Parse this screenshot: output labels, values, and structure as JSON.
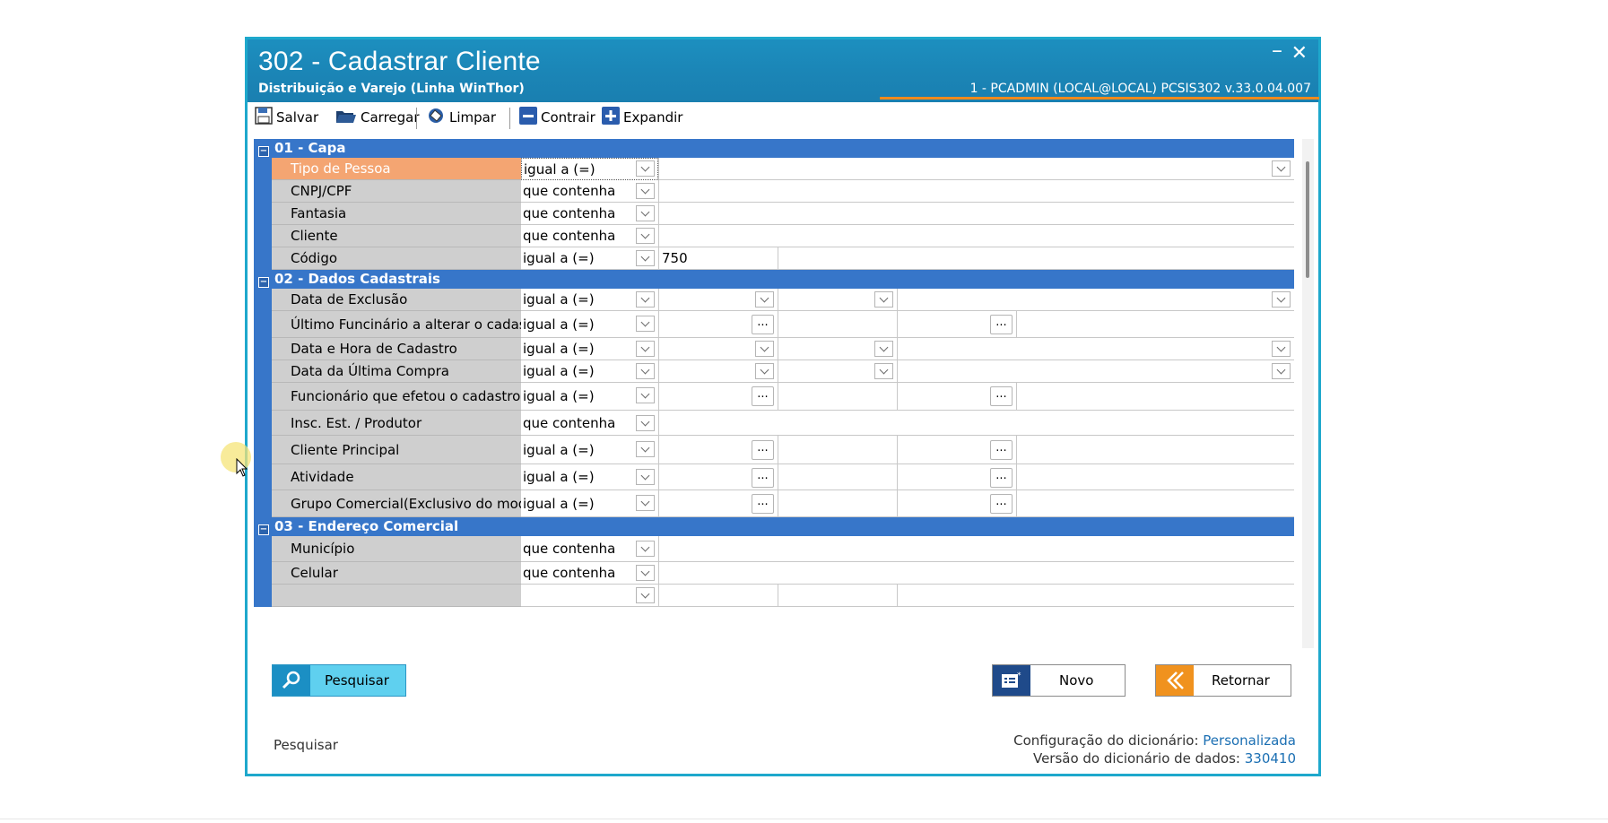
{
  "window": {
    "title": "302 - Cadastrar Cliente",
    "subtitle": "Distribuição e Varejo (Linha WinThor)",
    "session": "1 - PCADMIN (LOCAL@LOCAL)   PCSIS302  v.33.0.04.007",
    "minimize": "–",
    "close": "✕"
  },
  "toolbar": {
    "salvar": "Salvar",
    "carregar": "Carregar",
    "limpar": "Limpar",
    "contrair": "Contrair",
    "expandir": "Expandir"
  },
  "groups": [
    {
      "header": "01 - Capa",
      "rows": [
        {
          "label": "Tipo de Pessoa",
          "operator": "igual a (=)"
        },
        {
          "label": "CNPJ/CPF",
          "operator": "que contenha"
        },
        {
          "label": "Fantasia",
          "operator": "que contenha"
        },
        {
          "label": "Cliente",
          "operator": "que contenha"
        },
        {
          "label": "Código",
          "operator": "igual a (=)",
          "value": "750"
        }
      ]
    },
    {
      "header": "02 - Dados Cadastrais",
      "rows": [
        {
          "label": "Data de Exclusão",
          "operator": "igual a (=)"
        },
        {
          "label": "Último Funcinário a alterar o cadastro",
          "operator": "igual a (=)"
        },
        {
          "label": "Data e Hora de Cadastro",
          "operator": "igual a (=)"
        },
        {
          "label": "Data da Última Compra",
          "operator": "igual a (=)"
        },
        {
          "label": "Funcionário que efetou o cadastro",
          "operator": "igual a (=)"
        },
        {
          "label": "Insc. Est. / Produtor",
          "operator": "que contenha"
        },
        {
          "label": "Cliente Principal",
          "operator": "igual a (=)"
        },
        {
          "label": "Atividade",
          "operator": "igual a (=)"
        },
        {
          "label": "Grupo Comercial(Exclusivo do modulo",
          "operator": "igual a (=)"
        }
      ]
    },
    {
      "header": "03 - Endereço Comercial",
      "rows": [
        {
          "label": "Município",
          "operator": "que contenha"
        },
        {
          "label": "Celular",
          "operator": "que contenha"
        }
      ]
    }
  ],
  "ellipsis": "...",
  "buttons": {
    "pesquisar": "Pesquisar",
    "novo": "Novo",
    "retornar": "Retornar"
  },
  "status": {
    "left": "Pesquisar",
    "config_label": "Configuração do dicionário:",
    "config_value": "Personalizada",
    "version_label": "Versão do dicionário de dados:",
    "version_value": "330410"
  },
  "colors": {
    "title_bar": "#1b85b6",
    "group_header": "#3776c9",
    "active_row": "#f4a572",
    "accent_orange": "#f08a1c"
  }
}
